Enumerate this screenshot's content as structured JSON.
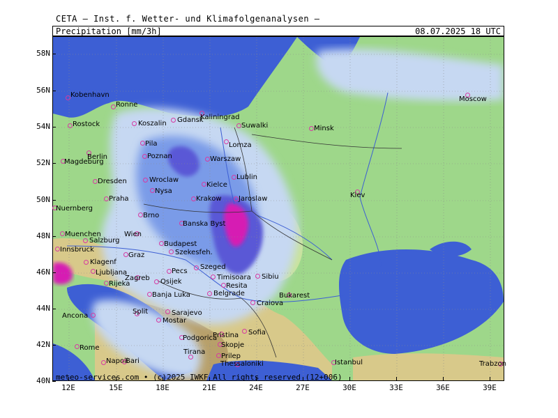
{
  "header": "CETA – Inst. f. Wetter- und Klimafolgenanalysen –",
  "title_left": "Precipitation",
  "unit": "[mm/3h]",
  "title_right": "08.07.2025  18 UTC",
  "credit": "meteo-services.com • (c)2025 IWKF All rights reserved (12+006)",
  "colors": {
    "sea": "#3d5fd4",
    "land_low": "#9ed78a",
    "land_mid": "#c9e39a",
    "land_high": "#d8c98a",
    "mountain": "#b8a06a",
    "precip_light": "#c6d8f2",
    "precip_mid": "#7a9be8",
    "precip_heavy": "#5a58d6",
    "precip_extreme": "#d61fb3"
  },
  "lat_labels": [
    "58N",
    "56N",
    "54N",
    "52N",
    "50N",
    "48N",
    "46N",
    "44N",
    "42N",
    "40N"
  ],
  "lon_labels": [
    "12E",
    "15E",
    "18E",
    "21E",
    "24E",
    "27E",
    "30E",
    "33E",
    "36E",
    "39E"
  ],
  "cities": [
    {
      "name": "Kobenhavn"
    },
    {
      "name": "Ronne"
    },
    {
      "name": "Rostock"
    },
    {
      "name": "Koszalin"
    },
    {
      "name": "Gdansk"
    },
    {
      "name": "Kaliningrad"
    },
    {
      "name": "Suwalki"
    },
    {
      "name": "Minsk"
    },
    {
      "name": "Moscow"
    },
    {
      "name": "Pila"
    },
    {
      "name": "Berlin"
    },
    {
      "name": "Magdeburg"
    },
    {
      "name": "Poznan"
    },
    {
      "name": "Lomza"
    },
    {
      "name": "Warszaw"
    },
    {
      "name": "Dresden"
    },
    {
      "name": "Wroclaw"
    },
    {
      "name": "Kielce"
    },
    {
      "name": "Lublin"
    },
    {
      "name": "Nysa"
    },
    {
      "name": "Praha"
    },
    {
      "name": "Krakow"
    },
    {
      "name": "Jaroslaw"
    },
    {
      "name": "Kiev"
    },
    {
      "name": "Nuernberg"
    },
    {
      "name": "Brno"
    },
    {
      "name": "Banska Byst"
    },
    {
      "name": "Muenchen"
    },
    {
      "name": "Wien"
    },
    {
      "name": "Salzburg"
    },
    {
      "name": "Budapest"
    },
    {
      "name": "Szekesfeh."
    },
    {
      "name": "Innsbruck"
    },
    {
      "name": "Graz"
    },
    {
      "name": "Klagenf"
    },
    {
      "name": "Szeged"
    },
    {
      "name": "Ljubljana"
    },
    {
      "name": "Pecs"
    },
    {
      "name": "Zagreb"
    },
    {
      "name": "Osijek"
    },
    {
      "name": "Timisoara"
    },
    {
      "name": "Sibiu"
    },
    {
      "name": "Rijeka"
    },
    {
      "name": "Resita"
    },
    {
      "name": "Banja Luka"
    },
    {
      "name": "Belgrade"
    },
    {
      "name": "Bukarest"
    },
    {
      "name": "Craiova"
    },
    {
      "name": "Ancona"
    },
    {
      "name": "Split"
    },
    {
      "name": "Sarajevo"
    },
    {
      "name": "Mostar"
    },
    {
      "name": "Pristina"
    },
    {
      "name": "Sofia"
    },
    {
      "name": "Podgorica"
    },
    {
      "name": "Skopje"
    },
    {
      "name": "Tirana"
    },
    {
      "name": "Rome"
    },
    {
      "name": "Prilep"
    },
    {
      "name": "Napoli"
    },
    {
      "name": "Bari"
    },
    {
      "name": "Thessaloniki"
    },
    {
      "name": "Istanbul"
    },
    {
      "name": "Trabzon"
    }
  ]
}
